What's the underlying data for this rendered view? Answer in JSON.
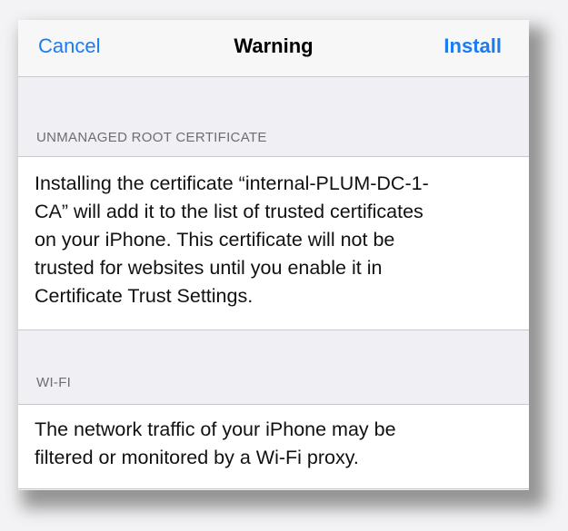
{
  "navbar": {
    "cancel_label": "Cancel",
    "title": "Warning",
    "install_label": "Install"
  },
  "sections": [
    {
      "header": "UNMANAGED ROOT CERTIFICATE",
      "body_lines": [
        "Installing the certificate “internal-PLUM-DC-1-",
        "CA” will add it to the list of trusted certificates",
        "on your iPhone. This certificate will not be",
        "trusted for websites until you enable it in",
        "Certificate Trust Settings."
      ]
    },
    {
      "header": "WI-FI",
      "body_lines": [
        "The network traffic of your iPhone may be",
        "filtered or monitored by a Wi-Fi proxy."
      ]
    }
  ],
  "colors": {
    "accent": "#1a7cf4",
    "background": "#efeff4",
    "header_text": "#6d6d72"
  }
}
